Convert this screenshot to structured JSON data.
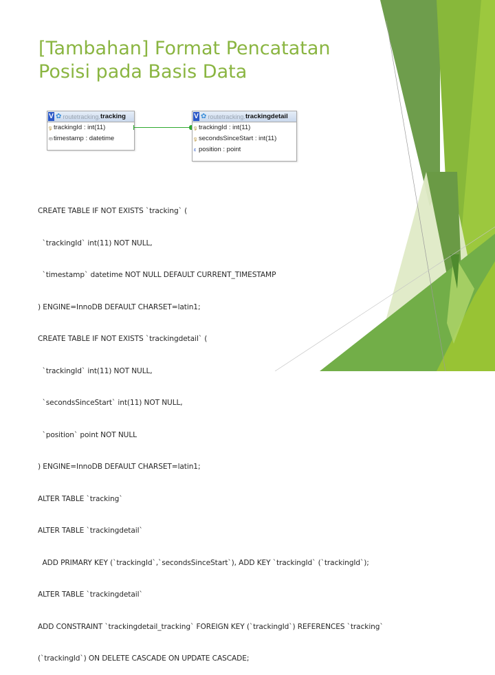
{
  "slide": {
    "title_lines": [
      "[Tambahan] Format Pencatatan",
      "Posisi pada Basis Data"
    ],
    "theme_colors": {
      "title": "#8ab541",
      "accent_dark": "#6a9a45",
      "accent_mid": "#8bb93a",
      "accent_light": "#9dc83f",
      "accent_pale": "#dde9c2"
    }
  },
  "diagram": {
    "tables": [
      {
        "database": "routetracking",
        "name": "tracking",
        "columns": [
          {
            "icon": "key-icon",
            "text": "trackingId : int(11)"
          },
          {
            "icon": "index-icon",
            "text": "timestamp : datetime"
          }
        ]
      },
      {
        "database": "routetracking",
        "name": "trackingdetail",
        "columns": [
          {
            "icon": "key-icon",
            "text": "trackingId : int(11)"
          },
          {
            "icon": "key-icon",
            "text": "secondsSinceStart : int(11)"
          },
          {
            "icon": "geometry-icon",
            "text": "position : point"
          }
        ]
      }
    ],
    "header_icon_letter": "V",
    "db_separator": "."
  },
  "sql_lines": [
    "CREATE TABLE IF NOT EXISTS `tracking` (",
    "  `trackingId` int(11) NOT NULL,",
    "  `timestamp` datetime NOT NULL DEFAULT CURRENT_TIMESTAMP",
    ") ENGINE=InnoDB DEFAULT CHARSET=latin1;",
    "CREATE TABLE IF NOT EXISTS `trackingdetail` (",
    "  `trackingId` int(11) NOT NULL,",
    "  `secondsSinceStart` int(11) NOT NULL,",
    "  `position` point NOT NULL",
    ") ENGINE=InnoDB DEFAULT CHARSET=latin1;",
    "ALTER TABLE `tracking`",
    "ALTER TABLE `trackingdetail`",
    "  ADD PRIMARY KEY (`trackingId`,`secondsSinceStart`), ADD KEY `trackingId` (`trackingId`);",
    "ALTER TABLE `trackingdetail`",
    "ADD CONSTRAINT `trackingdetail_tracking` FOREIGN KEY (`trackingId`) REFERENCES `tracking`",
    "(`trackingId`) ON DELETE CASCADE ON UPDATE CASCADE;"
  ]
}
